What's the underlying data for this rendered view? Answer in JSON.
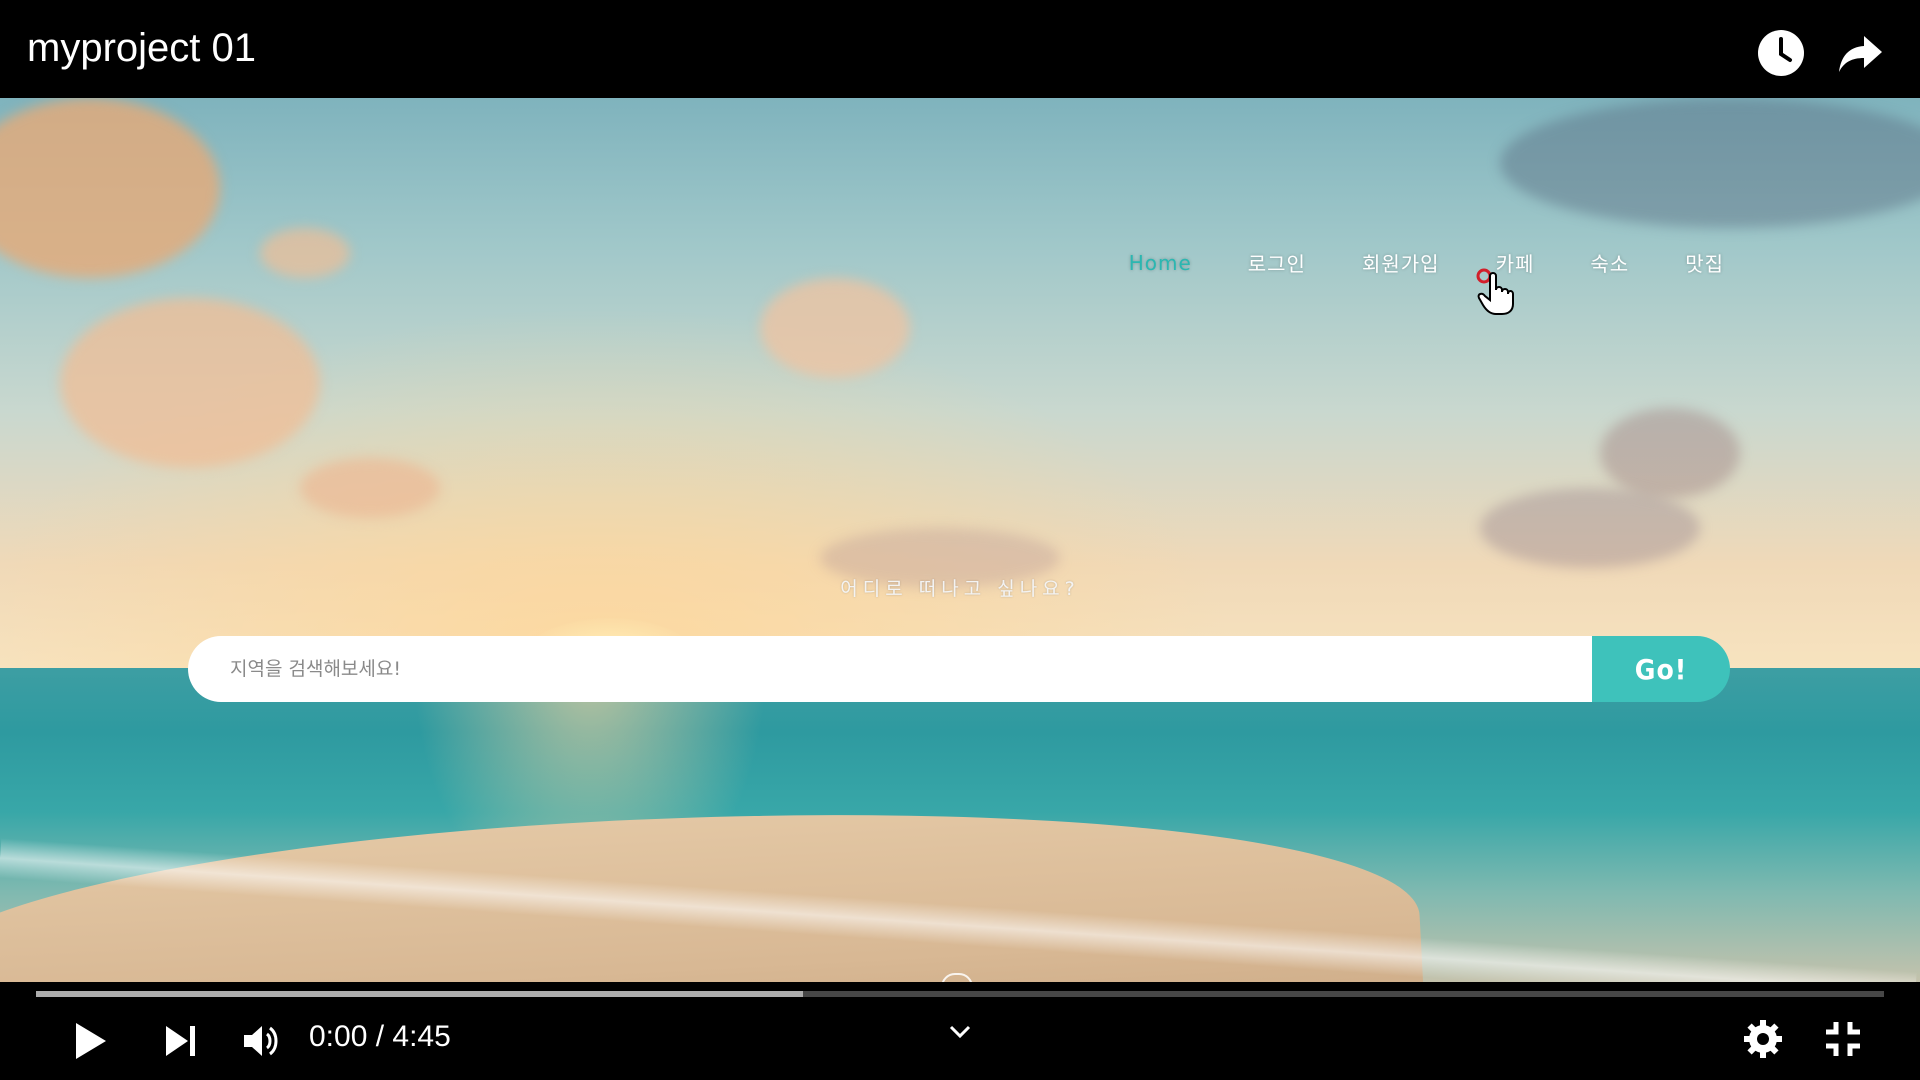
{
  "player": {
    "title": "myproject 01",
    "time_display": "0:00 / 4:45",
    "buffered_fraction": 0.415
  },
  "site": {
    "nav": [
      {
        "label": "Home",
        "active": true
      },
      {
        "label": "로그인",
        "active": false
      },
      {
        "label": "회원가입",
        "active": false
      },
      {
        "label": "카페",
        "active": false
      },
      {
        "label": "숙소",
        "active": false
      },
      {
        "label": "맛집",
        "active": false
      }
    ],
    "headline": "어디로 떠나고 싶나요?",
    "search": {
      "placeholder": "지역을 검색해보세요!",
      "button_label": "Go!"
    }
  },
  "colors": {
    "accent": "#3ec2bb",
    "active_nav": "#2bb7b1"
  },
  "icons": {
    "watch_later": "clock-icon",
    "share": "share-icon",
    "play": "play-icon",
    "next": "next-icon",
    "volume": "volume-icon",
    "chevron": "chevron-down-icon",
    "settings": "gear-icon",
    "exit_fullscreen": "exit-fullscreen-icon"
  }
}
